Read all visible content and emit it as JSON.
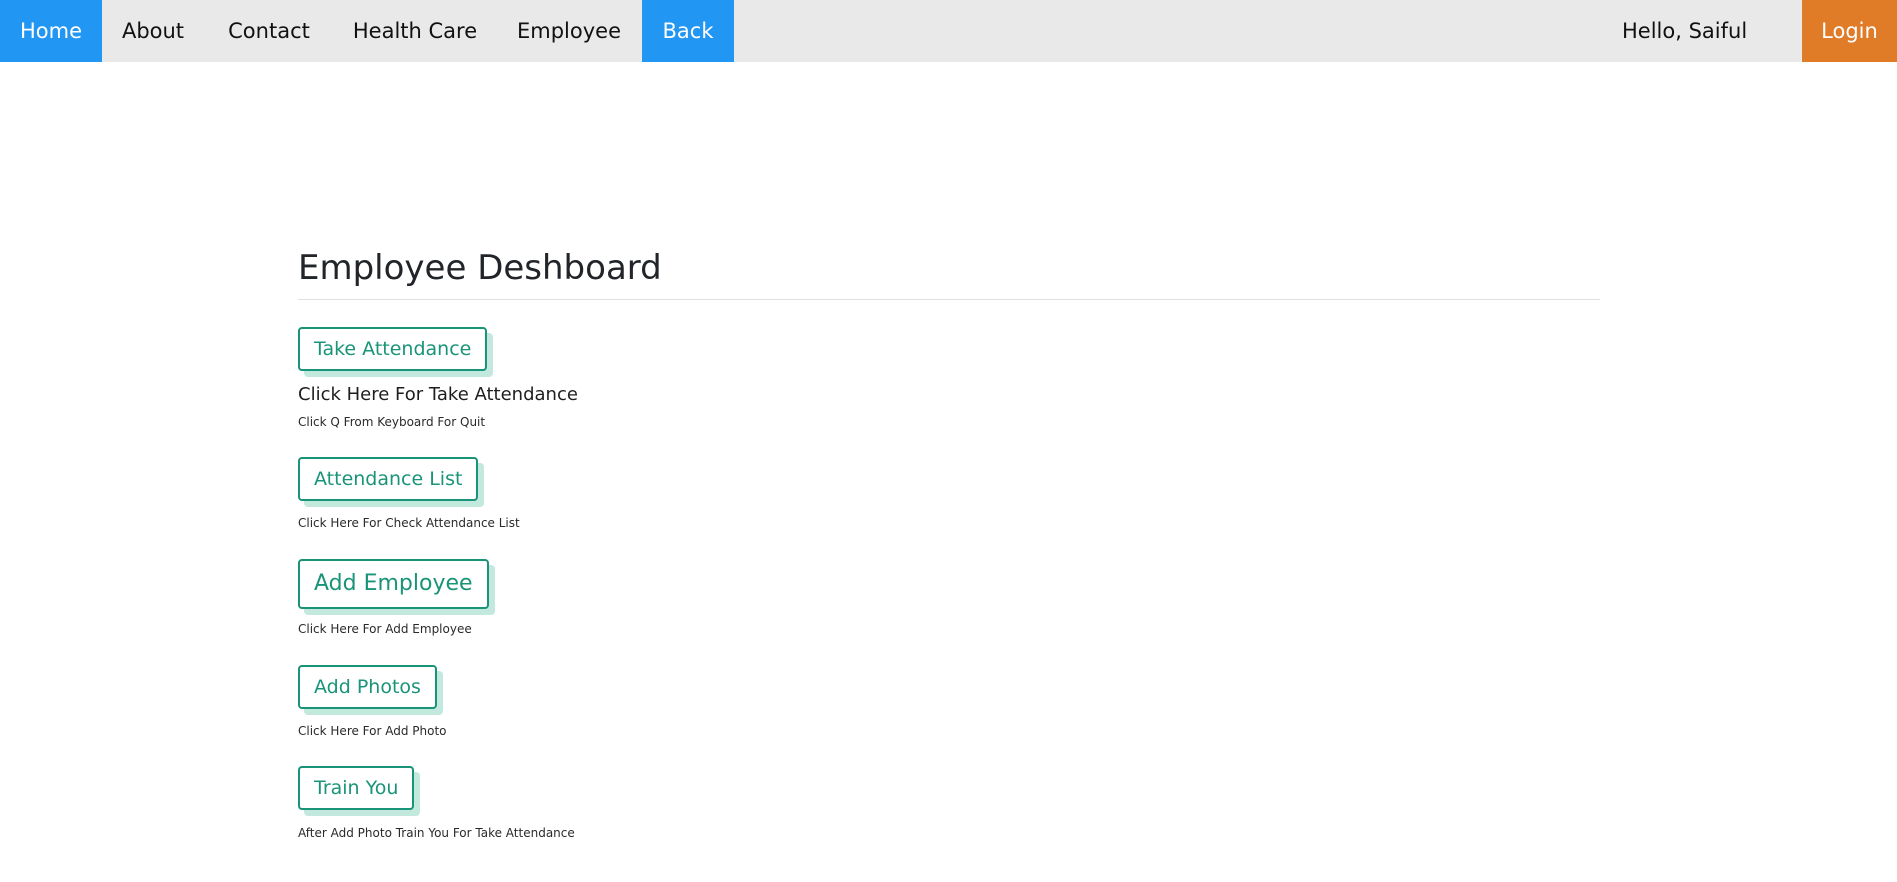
{
  "navbar": {
    "items": [
      {
        "label": "Home",
        "active": true
      },
      {
        "label": "About",
        "active": false
      },
      {
        "label": "Contact",
        "active": false
      },
      {
        "label": "Health Care",
        "active": false
      },
      {
        "label": "Employee",
        "active": false
      },
      {
        "label": "Back",
        "active": true
      }
    ],
    "greeting": "Hello, Saiful",
    "login_label": "Login"
  },
  "main": {
    "title": "Employee Deshboard",
    "sections": [
      {
        "button_label": "Take Attendance",
        "subheading": "Click Here For Take Attendance",
        "hint": "Click Q From Keyboard For Quit"
      },
      {
        "button_label": "Attendance List",
        "hint": "Click Here For Check Attendance List"
      },
      {
        "button_label": "Add Employee",
        "hint": "Click Here For Add Employee"
      },
      {
        "button_label": "Add Photos",
        "hint": "Click Here For Add Photo"
      },
      {
        "button_label": "Train You",
        "hint": "After Add Photo Train You For Take Attendance"
      }
    ]
  },
  "colors": {
    "nav_background": "#e9e9e9",
    "nav_active": "#2196f3",
    "login": "#e07b28",
    "button_accent": "#1a9479",
    "button_shadow": "#c3e8de"
  }
}
